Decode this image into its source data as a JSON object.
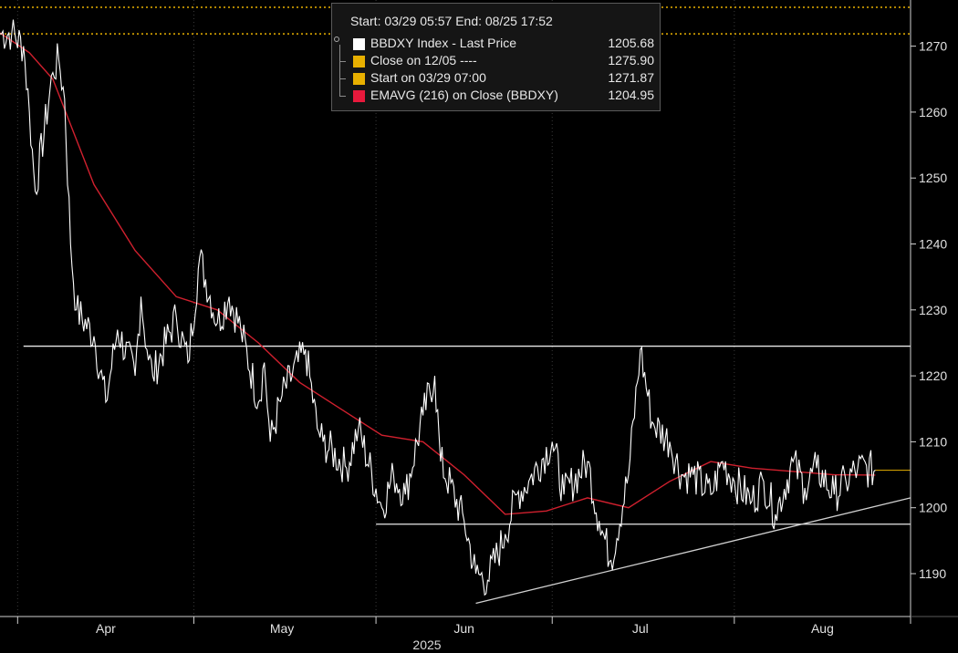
{
  "legend": {
    "header": "Start: 03/29 05:57 End: 08/25 17:52",
    "items": [
      {
        "label": "BBDXY Index - Last Price",
        "value": "1205.68",
        "color": "#ffffff"
      },
      {
        "label": "Close on 12/05 ----",
        "value": "1275.90",
        "color": "#e8b000"
      },
      {
        "label": "Start on 03/29 07:00",
        "value": "1271.87",
        "color": "#e8b000"
      },
      {
        "label": "EMAVG (216)  on Close (BBDXY)",
        "value": "1204.95",
        "color": "#e8193c"
      }
    ]
  },
  "colors": {
    "background": "#000000",
    "price": "#ffffff",
    "ema": "#d0202e",
    "reference": "#e8b000",
    "grid": "#3a3a3a",
    "trendline": "#d0d0d0"
  },
  "chart_data": {
    "type": "line",
    "xlabel": "2025",
    "x_ticks": [
      "Apr",
      "May",
      "Jun",
      "Jul",
      "Aug"
    ],
    "y_ticks": [
      1190,
      1200,
      1210,
      1220,
      1230,
      1240,
      1250,
      1260,
      1270
    ],
    "ylim": [
      1183.5,
      1277
    ],
    "xlim": [
      "2025-03-29",
      "2025-08-31"
    ],
    "grid": "vertical dotted",
    "legend_position": "top-center",
    "series": [
      {
        "name": "BBDXY Index - Last Price",
        "x": [
          "2025-03-29",
          "2025-03-31",
          "2025-04-02",
          "2025-04-03",
          "2025-04-04",
          "2025-04-07",
          "2025-04-08",
          "2025-04-09",
          "2025-04-10",
          "2025-04-11",
          "2025-04-14",
          "2025-04-16",
          "2025-04-18",
          "2025-04-21",
          "2025-04-22",
          "2025-04-23",
          "2025-04-24",
          "2025-04-28",
          "2025-04-30",
          "2025-05-02",
          "2025-05-05",
          "2025-05-07",
          "2025-05-09",
          "2025-05-12",
          "2025-05-13",
          "2025-05-14",
          "2025-05-16",
          "2025-05-20",
          "2025-05-22",
          "2025-05-23",
          "2025-05-27",
          "2025-05-29",
          "2025-06-02",
          "2025-06-04",
          "2025-06-06",
          "2025-06-09",
          "2025-06-11",
          "2025-06-12",
          "2025-06-16",
          "2025-06-18",
          "2025-06-20",
          "2025-06-23",
          "2025-06-25",
          "2025-06-27",
          "2025-07-01",
          "2025-07-03",
          "2025-07-07",
          "2025-07-09",
          "2025-07-11",
          "2025-07-14",
          "2025-07-16",
          "2025-07-18",
          "2025-07-21",
          "2025-07-23",
          "2025-07-25",
          "2025-07-28",
          "2025-07-30",
          "2025-08-01",
          "2025-08-04",
          "2025-08-06",
          "2025-08-08",
          "2025-08-11",
          "2025-08-13",
          "2025-08-15",
          "2025-08-18",
          "2025-08-20",
          "2025-08-22",
          "2025-08-25"
        ],
        "values": [
          1271.9,
          1272,
          1270,
          1260,
          1248,
          1266,
          1268,
          1262,
          1240,
          1230,
          1226,
          1216,
          1227,
          1220,
          1232,
          1224,
          1220,
          1229,
          1222,
          1238,
          1228,
          1232,
          1227,
          1216,
          1222,
          1210,
          1217,
          1224,
          1212,
          1210,
          1206,
          1212,
          1200,
          1205,
          1202,
          1214,
          1220,
          1207,
          1198,
          1190,
          1189,
          1196,
          1202,
          1204,
          1210,
          1202,
          1207,
          1198,
          1192,
          1205,
          1224,
          1213,
          1210,
          1205,
          1205,
          1202,
          1207,
          1204,
          1201,
          1204,
          1199,
          1207,
          1203,
          1206,
          1202,
          1204,
          1206,
          1205.68
        ]
      },
      {
        "name": "EMAVG (216)  on Close (BBDXY)",
        "x": [
          "2025-03-29",
          "2025-04-03",
          "2025-04-07",
          "2025-04-14",
          "2025-04-21",
          "2025-04-28",
          "2025-05-05",
          "2025-05-12",
          "2025-05-19",
          "2025-05-26",
          "2025-06-02",
          "2025-06-09",
          "2025-06-16",
          "2025-06-23",
          "2025-06-30",
          "2025-07-07",
          "2025-07-14",
          "2025-07-21",
          "2025-07-28",
          "2025-08-04",
          "2025-08-11",
          "2025-08-18",
          "2025-08-25"
        ],
        "values": [
          1272,
          1269,
          1265,
          1249,
          1239,
          1232,
          1230,
          1225,
          1219,
          1215,
          1211,
          1210,
          1205,
          1199,
          1199.5,
          1201.5,
          1200,
          1204,
          1207,
          1206,
          1205.5,
          1205,
          1204.95
        ]
      },
      {
        "name": "Close on 12/05 ----",
        "constant": 1275.9
      },
      {
        "name": "Start on 03/29 07:00",
        "constant": 1271.87
      }
    ],
    "annotations": [
      {
        "type": "horizontal-line",
        "y": 1224.5,
        "from": "2025-04-02",
        "to": "2025-08-31"
      },
      {
        "type": "horizontal-line",
        "y": 1197.5,
        "from": "2025-06-01",
        "to": "2025-08-31"
      },
      {
        "type": "trendline",
        "from": {
          "x": "2025-06-18",
          "y": 1185.5
        },
        "to": {
          "x": "2025-08-31",
          "y": 1201.5
        }
      }
    ],
    "last_value_label": 1205.68
  }
}
